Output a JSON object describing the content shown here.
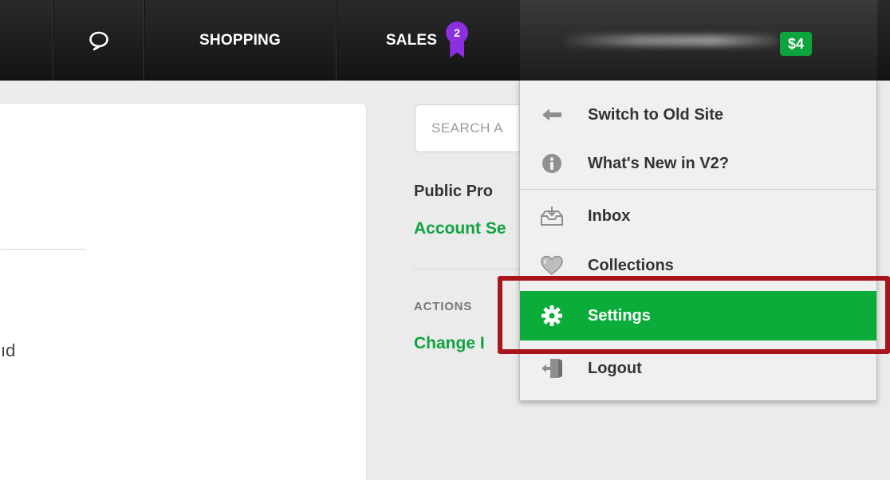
{
  "topbar": {
    "nav": [
      {
        "icon": "chat-bubble-icon"
      },
      {
        "label": "SHOPPING"
      },
      {
        "label": "SALES",
        "badge_count": "2",
        "badge_icon": "ribbon-badge-icon",
        "badge_color": "#8b2fe0"
      }
    ],
    "user": {
      "balance": "$4",
      "balance_color": "#0da43e"
    }
  },
  "main": {
    "card_text_fragment": "ıd"
  },
  "sidebar": {
    "search_placeholder": "SEARCH A",
    "public_profile": "Public Pro",
    "account_settings": "Account Se",
    "actions_heading": "ACTIONS",
    "change_link": "Change I"
  },
  "user_menu": {
    "items": [
      {
        "icon": "arrow-left-icon",
        "label": "Switch to Old Site"
      },
      {
        "icon": "info-circle-icon",
        "label": "What's New in V2?"
      },
      {
        "icon": "inbox-tray-icon",
        "label": "Inbox"
      },
      {
        "icon": "heart-icon",
        "label": "Collections"
      },
      {
        "icon": "gear-icon",
        "label": "Settings",
        "active": true
      },
      {
        "icon": "logout-door-icon",
        "label": "Logout"
      }
    ],
    "active_color": "#0bac3a",
    "highlight_color": "#a8141a"
  }
}
